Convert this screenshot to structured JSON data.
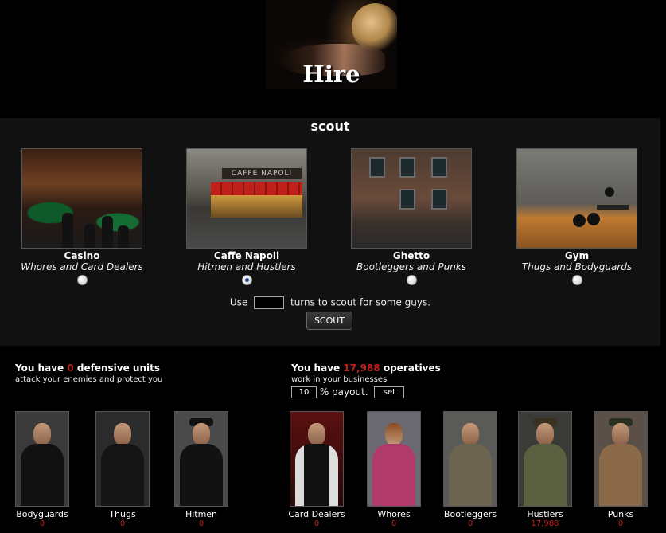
{
  "header": {
    "title": "Hire"
  },
  "scout": {
    "title": "scout",
    "locations": [
      {
        "name": "Casino",
        "desc": "Whores and Card Dealers",
        "selected": false,
        "scene": "casino-scene"
      },
      {
        "name": "Caffe Napoli",
        "desc": "Hitmen and Hustlers",
        "selected": true,
        "scene": "caffe-scene",
        "sign": "CAFFE NAPOLI"
      },
      {
        "name": "Ghetto",
        "desc": "Bootleggers and Punks",
        "selected": false,
        "scene": "ghetto-scene"
      },
      {
        "name": "Gym",
        "desc": "Thugs and Bodyguards",
        "selected": false,
        "scene": "gym-scene"
      }
    ],
    "use_prefix": "Use",
    "use_suffix": "turns to scout for some guys.",
    "turns_value": "",
    "button_label": "SCOUT"
  },
  "defensive": {
    "prefix": "You have",
    "count": "0",
    "suffix": "defensive units",
    "sub": "attack your enemies and protect you",
    "units": [
      {
        "label": "Bodyguards",
        "count": "0",
        "color": "#1a1a1a"
      },
      {
        "label": "Thugs",
        "count": "0",
        "color": "#202020"
      },
      {
        "label": "Hitmen",
        "count": "0",
        "color": "#181818"
      }
    ]
  },
  "operatives": {
    "prefix": "You have",
    "count": "17,988",
    "suffix": "operatives",
    "sub": "work in your businesses",
    "payout_value": "10",
    "payout_label": "% payout.",
    "set_label": "set",
    "units": [
      {
        "label": "Card Dealers",
        "count": "0",
        "color": "#1b1b1b"
      },
      {
        "label": "Whores",
        "count": "0",
        "color": "#a0305a"
      },
      {
        "label": "Bootleggers",
        "count": "0",
        "color": "#6a6450"
      },
      {
        "label": "Hustlers",
        "count": "17,988",
        "color": "#5a6040"
      },
      {
        "label": "Punks",
        "count": "0",
        "color": "#8a6a48"
      }
    ]
  },
  "colors": {
    "accent_red": "#c0201a",
    "panel": "#111111",
    "background": "#000000"
  }
}
